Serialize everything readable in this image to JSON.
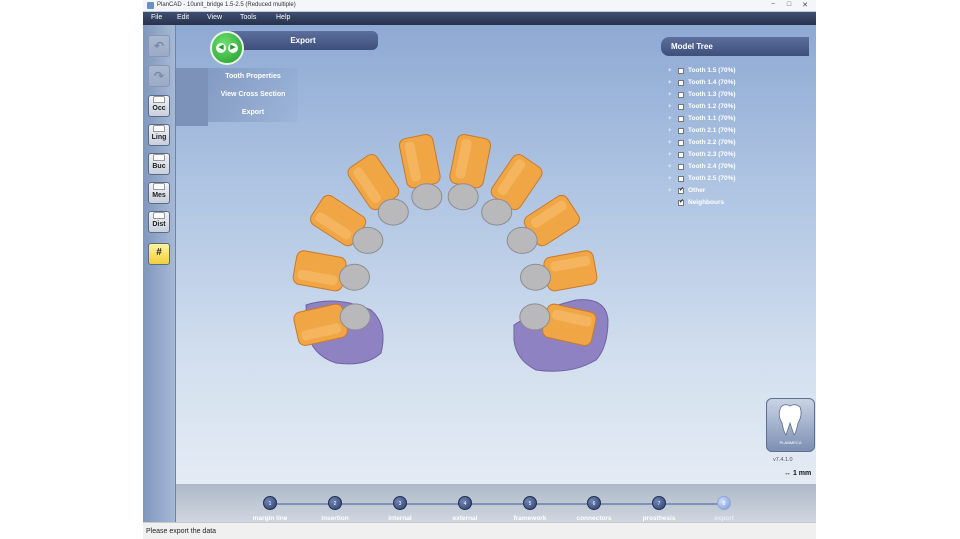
{
  "window": {
    "title": "PlanCAD - 10unit_bridge 1.5-2.5 (Reduced multiple)",
    "controls": [
      "−",
      "□",
      "✕"
    ]
  },
  "menu": [
    "File",
    "Edit",
    "View",
    "Tools",
    "Help"
  ],
  "toolbar": {
    "undo_icon": "↶",
    "redo_icon": "↷",
    "buttons": [
      "Occ",
      "Ling",
      "Buc",
      "Mes",
      "Dist",
      "#"
    ]
  },
  "navigation": {
    "left_arrow": "◀",
    "right_arrow": "▶"
  },
  "panel": {
    "header": "Export",
    "items": [
      "Tooth Properties",
      "View Cross Section",
      "Export"
    ]
  },
  "model_tree": {
    "header": "Model Tree",
    "items": [
      {
        "label": "Tooth 1.5 (70%)",
        "checked": false,
        "expand": "+"
      },
      {
        "label": "Tooth 1.4 (70%)",
        "checked": false,
        "expand": "+"
      },
      {
        "label": "Tooth 1.3 (70%)",
        "checked": false,
        "expand": "+"
      },
      {
        "label": "Tooth 1.2 (70%)",
        "checked": false,
        "expand": "+"
      },
      {
        "label": "Tooth 1.1 (70%)",
        "checked": false,
        "expand": "+"
      },
      {
        "label": "Tooth 2.1 (70%)",
        "checked": false,
        "expand": "+"
      },
      {
        "label": "Tooth 2.2 (70%)",
        "checked": false,
        "expand": "+"
      },
      {
        "label": "Tooth 2.3 (70%)",
        "checked": false,
        "expand": "+"
      },
      {
        "label": "Tooth 2.4 (70%)",
        "checked": false,
        "expand": "+"
      },
      {
        "label": "Tooth 2.5 (70%)",
        "checked": false,
        "expand": "+"
      },
      {
        "label": "Other",
        "checked": true,
        "expand": "+"
      },
      {
        "label": "Neighbours",
        "checked": true,
        "expand": ""
      }
    ]
  },
  "brand": {
    "name": "PLANMECA",
    "version": "v7.4.1.0",
    "scale": "1 mm",
    "scale_icon": "↔"
  },
  "workflow": {
    "steps": [
      {
        "num": "1",
        "label": "margin line"
      },
      {
        "num": "2",
        "label": "insertion"
      },
      {
        "num": "3",
        "label": "internal"
      },
      {
        "num": "4",
        "label": "external"
      },
      {
        "num": "5",
        "label": "framework"
      },
      {
        "num": "6",
        "label": "connectors"
      },
      {
        "num": "7",
        "label": "prosthesis"
      },
      {
        "num": "8",
        "label": "export"
      }
    ],
    "active_step": 8
  },
  "status": "Please export the data",
  "colors": {
    "crown": "#f0a645",
    "crown_edge": "#c9782a",
    "framework": "#b9b9bc",
    "neighbour": "#8f82c2",
    "accent": "#3e4f7b"
  }
}
